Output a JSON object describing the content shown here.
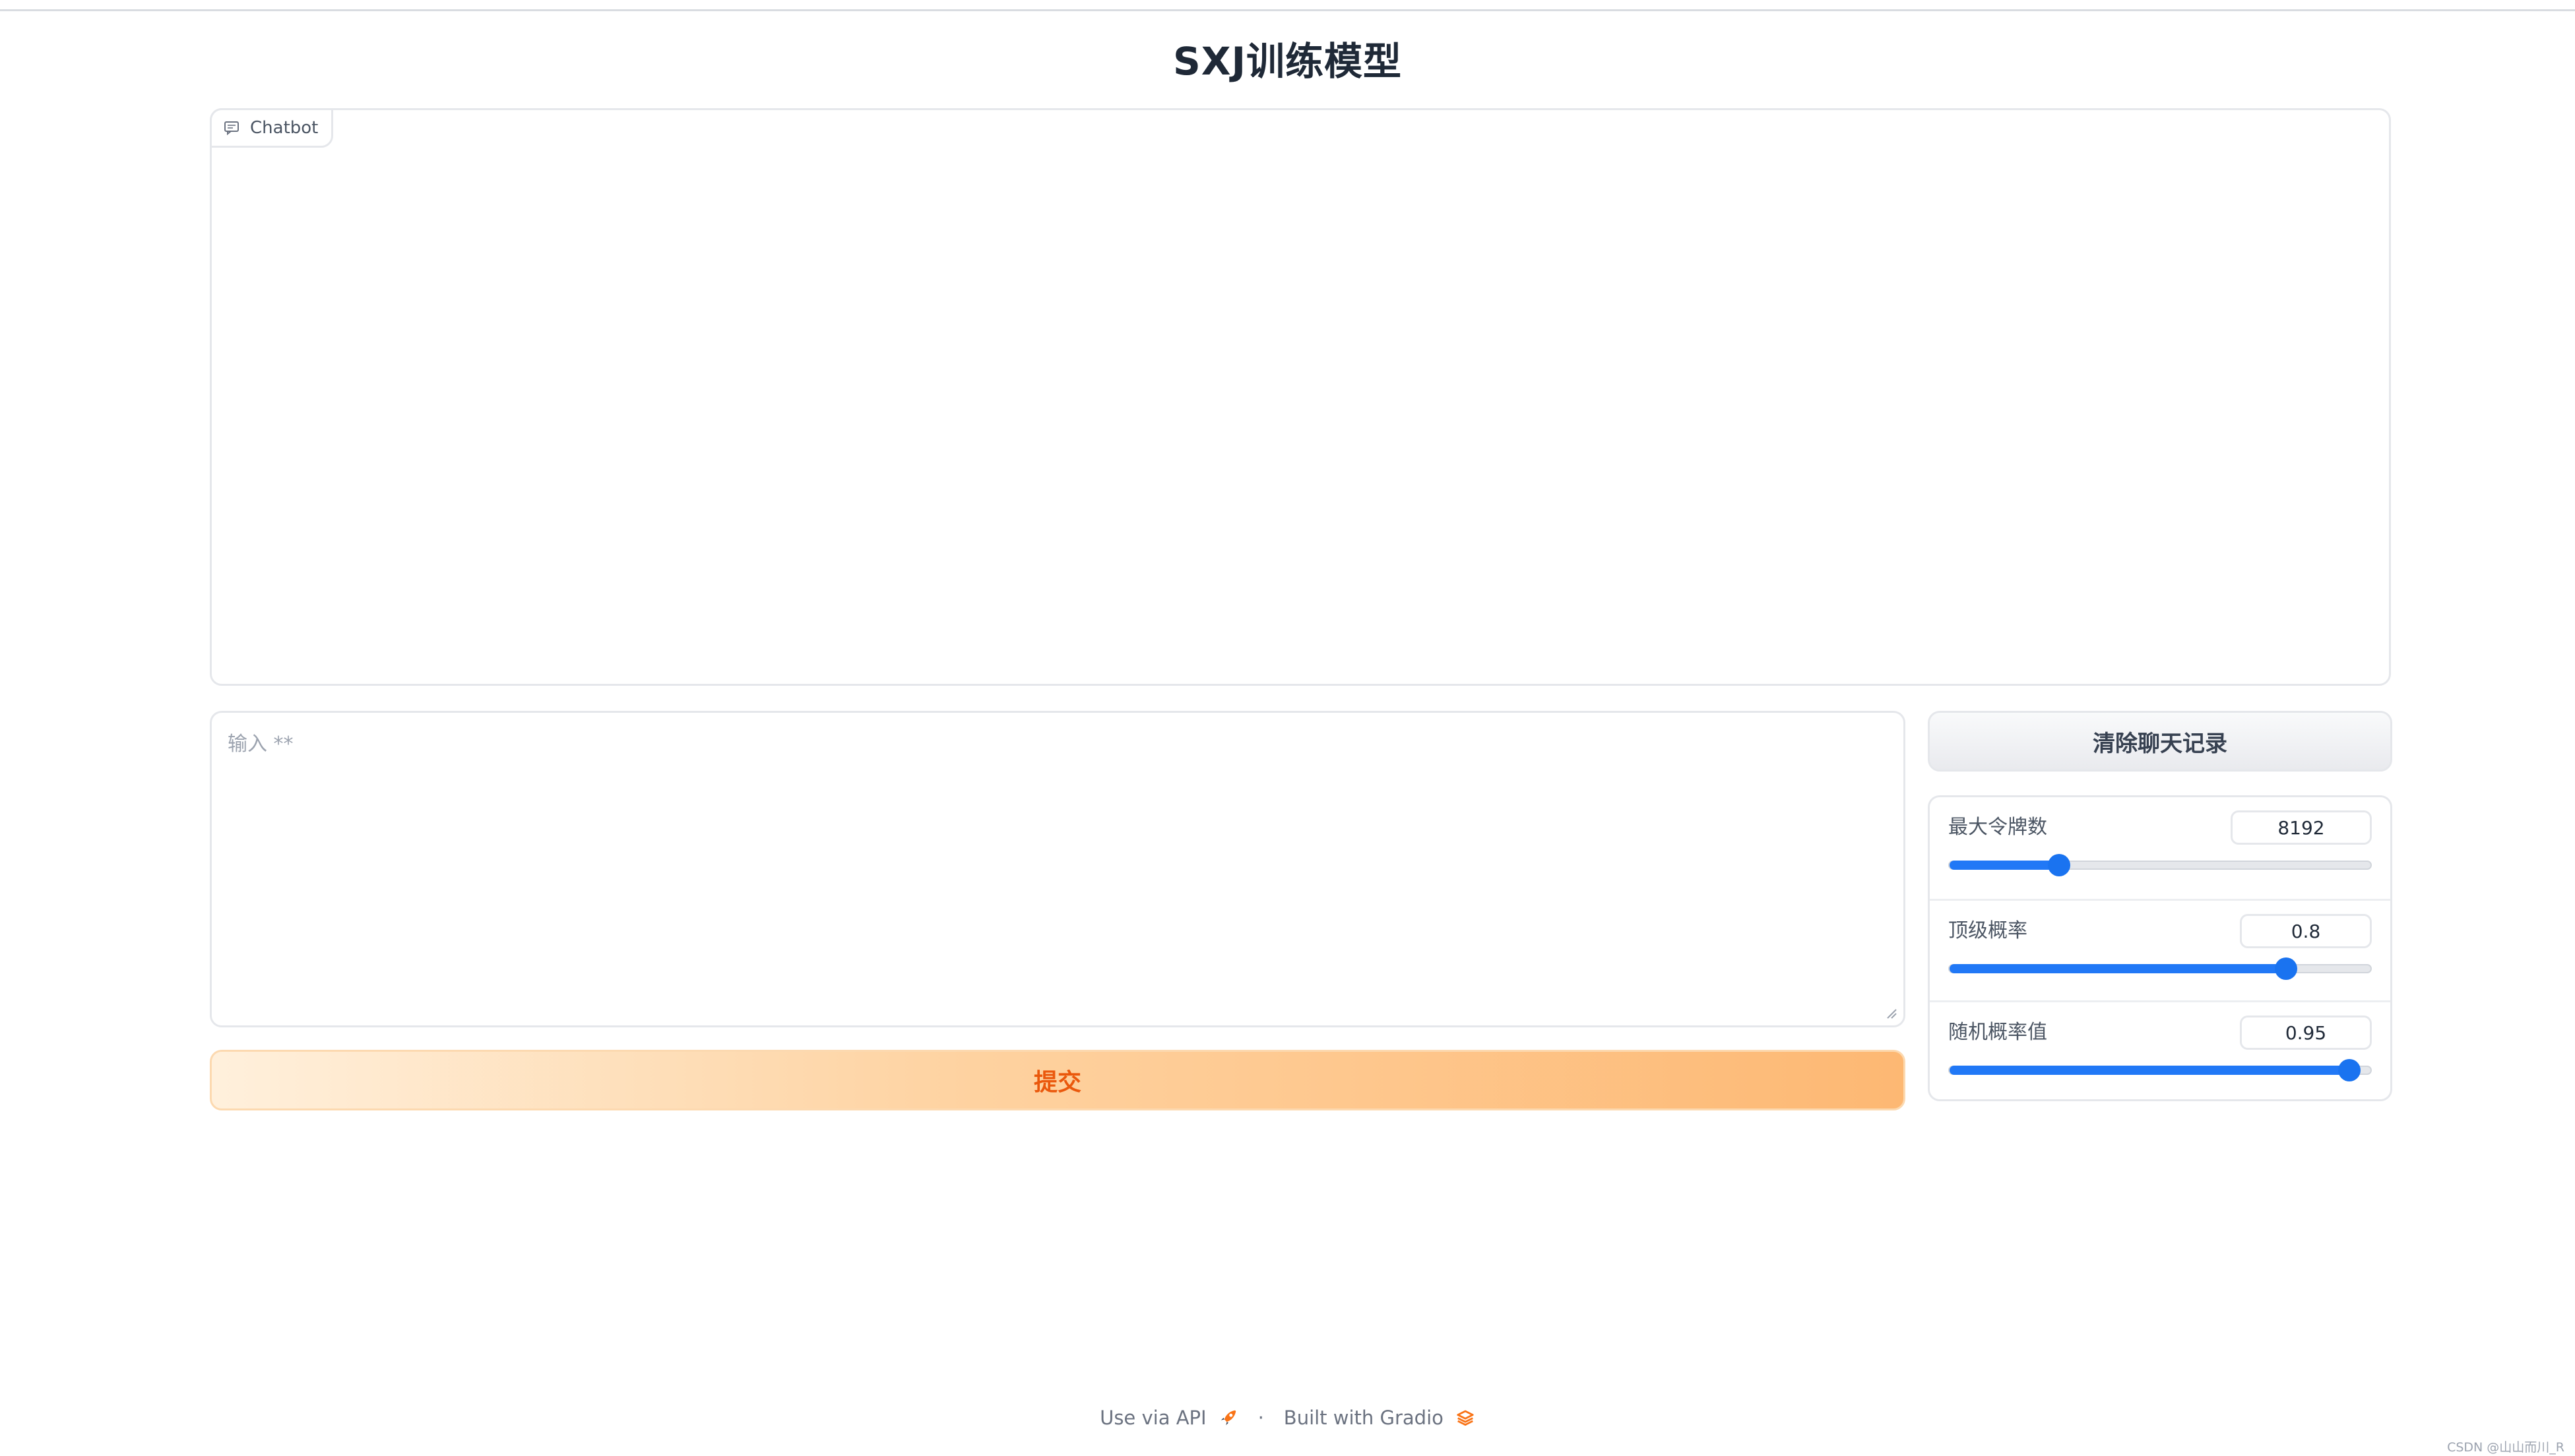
{
  "app": {
    "title": "SXJ训练模型"
  },
  "chatbot": {
    "label": "Chatbot",
    "icon": "chat-bubble-icon"
  },
  "input": {
    "placeholder": "输入 **",
    "value": ""
  },
  "buttons": {
    "submit_label": "提交",
    "clear_label": "清除聊天记录"
  },
  "params": {
    "max_tokens": {
      "label": "最大令牌数",
      "value": "8192",
      "fraction": 0.26
    },
    "top_p": {
      "label": "顶级概率",
      "value": "0.8",
      "fraction": 0.8
    },
    "temperature": {
      "label": "随机概率值",
      "value": "0.95",
      "fraction": 0.95
    }
  },
  "footer": {
    "api_label": "Use via API",
    "separator": "·",
    "built_label": "Built with Gradio"
  },
  "watermark": "CSDN @山山而川_R",
  "colors": {
    "accent_orange": "#ea580c",
    "slider_blue": "#1a73f0",
    "border": "#e5e7eb"
  }
}
